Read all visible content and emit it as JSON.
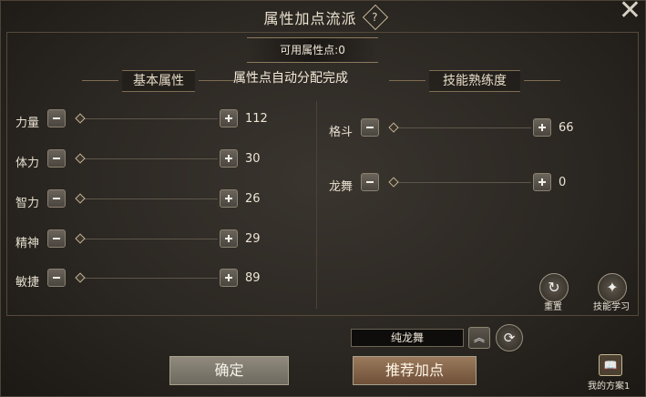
{
  "title": "属性加点流派",
  "help_icon_label": "?",
  "close_icon_label": "✕",
  "available_points": "可用属性点:0",
  "headers": {
    "basic": "基本属性",
    "skill": "技能熟练度"
  },
  "auto_message": "属性点自动分配完成",
  "basic_attributes": [
    {
      "label": "力量",
      "value": "112"
    },
    {
      "label": "体力",
      "value": "30"
    },
    {
      "label": "智力",
      "value": "26"
    },
    {
      "label": "精神",
      "value": "29"
    },
    {
      "label": "敏捷",
      "value": "89"
    }
  ],
  "skills": [
    {
      "label": "格斗",
      "value": "66"
    },
    {
      "label": "龙舞",
      "value": "0"
    }
  ],
  "round_buttons": {
    "reset_label": "重置",
    "skill_learn_label": "技能学习"
  },
  "preset": {
    "selected": "纯龙舞",
    "chevron_icon": "︽",
    "swap_icon": "⟳"
  },
  "buttons": {
    "confirm": "确定",
    "recommend": "推荐加点"
  },
  "scheme": {
    "label": "我的方案1",
    "icon": "📖"
  }
}
